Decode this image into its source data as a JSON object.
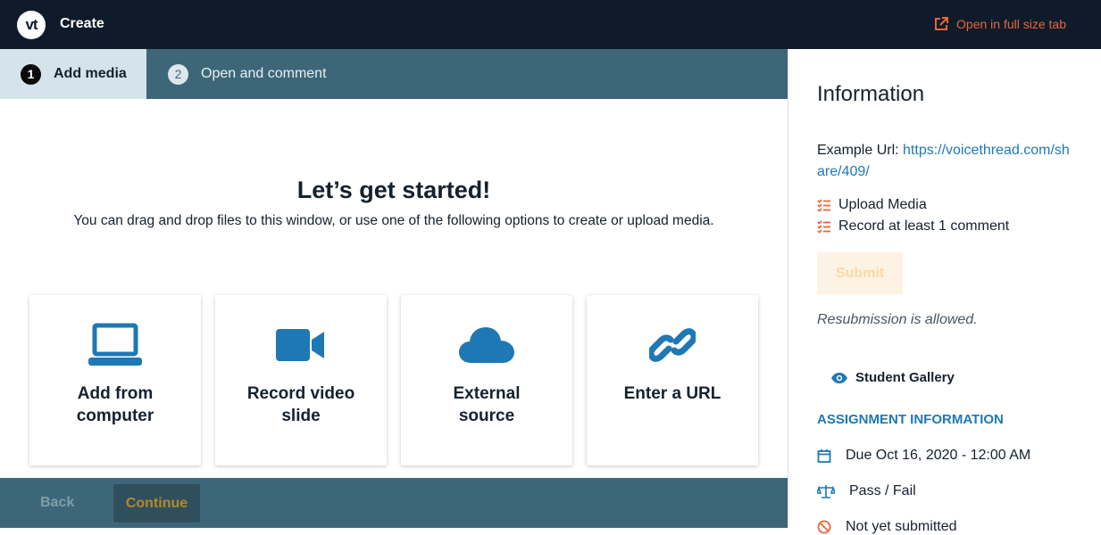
{
  "header": {
    "logo_text": "vt",
    "title": "Create",
    "open_full_size": "Open in full size tab",
    "accent_color": "#e8663a"
  },
  "steps": [
    {
      "number": "1",
      "label": "Add media"
    },
    {
      "number": "2",
      "label": "Open and comment"
    }
  ],
  "main": {
    "heading": "Let’s get started!",
    "subtext": "You can drag and drop files to this window, or use one of the following options to create or upload media.",
    "cards": [
      {
        "icon": "laptop-icon",
        "line1": "Add from",
        "line2": "computer"
      },
      {
        "icon": "video-camera-icon",
        "line1": "Record video",
        "line2": "slide"
      },
      {
        "icon": "cloud-icon",
        "line1": "External",
        "line2": "source"
      },
      {
        "icon": "link-icon",
        "line1": "Enter a URL",
        "line2": ""
      }
    ]
  },
  "footer": {
    "back_label": "Back",
    "continue_label": "Continue"
  },
  "panel": {
    "title": "Information",
    "example_url_label": "Example Url:",
    "example_url": "https://voicethread.com/share/409/",
    "requirements": [
      "Upload Media",
      "Record at least 1 comment"
    ],
    "submit_label": "Submit",
    "resubmission": "Resubmission is allowed.",
    "gallery_label": "Student Gallery",
    "assignment_heading": "ASSIGNMENT INFORMATION",
    "due": "Due Oct 16, 2020 - 12:00 AM",
    "grading": "Pass / Fail",
    "status": "Not yet submitted"
  }
}
